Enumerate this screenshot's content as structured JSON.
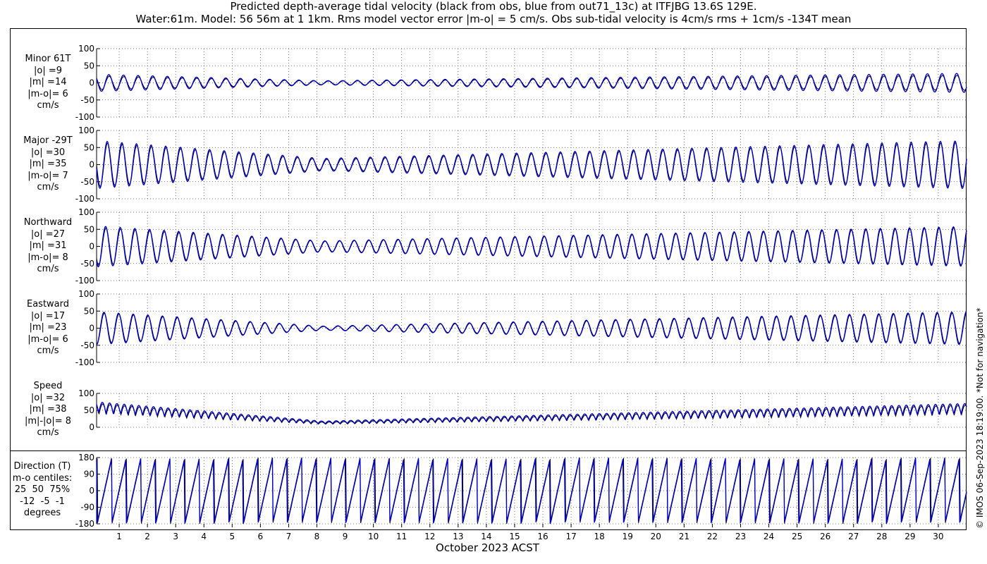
{
  "title": {
    "line1": "Predicted depth-average tidal velocity (black from obs, blue from out71_13c) at ITFJBG 13.6S 129E.",
    "line2": "Water:61m. Model: 56 56m at 1 1km. Rms model vector error |m-o| = 5 cm/s. Obs sub-tidal velocity is 4cm/s rms + 1cm/s -134T mean"
  },
  "xlabel": "October 2023 ACST",
  "credit": "© IMOS 06-Sep-2023 18:19:00.  *Not for navigation*",
  "colors": {
    "obs": "#000000",
    "model": "#0000cc",
    "grid": "#555555"
  },
  "chart_data": {
    "type": "line",
    "x_unit": "day of October 2023",
    "xlim": [
      0.2,
      31.0
    ],
    "x_ticks": [
      1,
      2,
      3,
      4,
      5,
      6,
      7,
      8,
      9,
      10,
      11,
      12,
      13,
      14,
      15,
      16,
      17,
      18,
      19,
      20,
      21,
      22,
      23,
      24,
      25,
      26,
      27,
      28,
      29,
      30
    ],
    "series_names": [
      "obs",
      "model"
    ],
    "panels": [
      {
        "name": "minor",
        "label_lines": [
          "Minor 61T",
          "|o| =9",
          "|m| =14",
          "|m-o|= 6",
          "cm/s"
        ],
        "ylim": [
          -100,
          100
        ],
        "yticks": [
          -100,
          -50,
          0,
          50,
          100
        ],
        "approx_amplitude_envelope": {
          "obs": [
            20,
            5,
            22
          ],
          "model": [
            25,
            6,
            28
          ]
        }
      },
      {
        "name": "major",
        "label_lines": [
          "Major -29T",
          "|o| =30",
          "|m| =35",
          "|m-o|= 7",
          "cm/s"
        ],
        "ylim": [
          -100,
          100
        ],
        "yticks": [
          -100,
          -50,
          0,
          50,
          100
        ],
        "approx_amplitude_envelope": {
          "obs": [
            65,
            15,
            65
          ],
          "model": [
            70,
            18,
            70
          ]
        }
      },
      {
        "name": "northward",
        "label_lines": [
          "Northward",
          "|o| =27",
          "|m| =31",
          "|m-o|= 8",
          "cm/s"
        ],
        "ylim": [
          -100,
          100
        ],
        "yticks": [
          -100,
          -50,
          0,
          50,
          100
        ],
        "approx_amplitude_envelope": {
          "obs": [
            55,
            15,
            55
          ],
          "model": [
            60,
            16,
            58
          ]
        }
      },
      {
        "name": "eastward",
        "label_lines": [
          "Eastward",
          "|o| =17",
          "|m| =23",
          "|m-o|= 6",
          "cm/s"
        ],
        "ylim": [
          -100,
          100
        ],
        "yticks": [
          -100,
          -50,
          0,
          50,
          100
        ],
        "approx_amplitude_envelope": {
          "obs": [
            45,
            5,
            45
          ],
          "model": [
            48,
            6,
            48
          ]
        }
      },
      {
        "name": "speed",
        "label_lines": [
          "Speed",
          "|o| =32",
          "|m| =38",
          "|m|-|o|= 8",
          "cm/s"
        ],
        "ylim": [
          0,
          100
        ],
        "yticks": [
          0,
          50,
          100
        ],
        "approx_amplitude_envelope": {
          "obs": [
            70,
            15,
            65
          ],
          "model": [
            75,
            18,
            70
          ]
        }
      },
      {
        "name": "direction",
        "label_lines": [
          "Direction (T)",
          "m-o centiles:",
          "25  50  75%",
          "-12  -5  -1",
          "degrees"
        ],
        "ylim": [
          -180,
          180
        ],
        "yticks": [
          -180,
          -90,
          0,
          90,
          180
        ]
      }
    ]
  }
}
